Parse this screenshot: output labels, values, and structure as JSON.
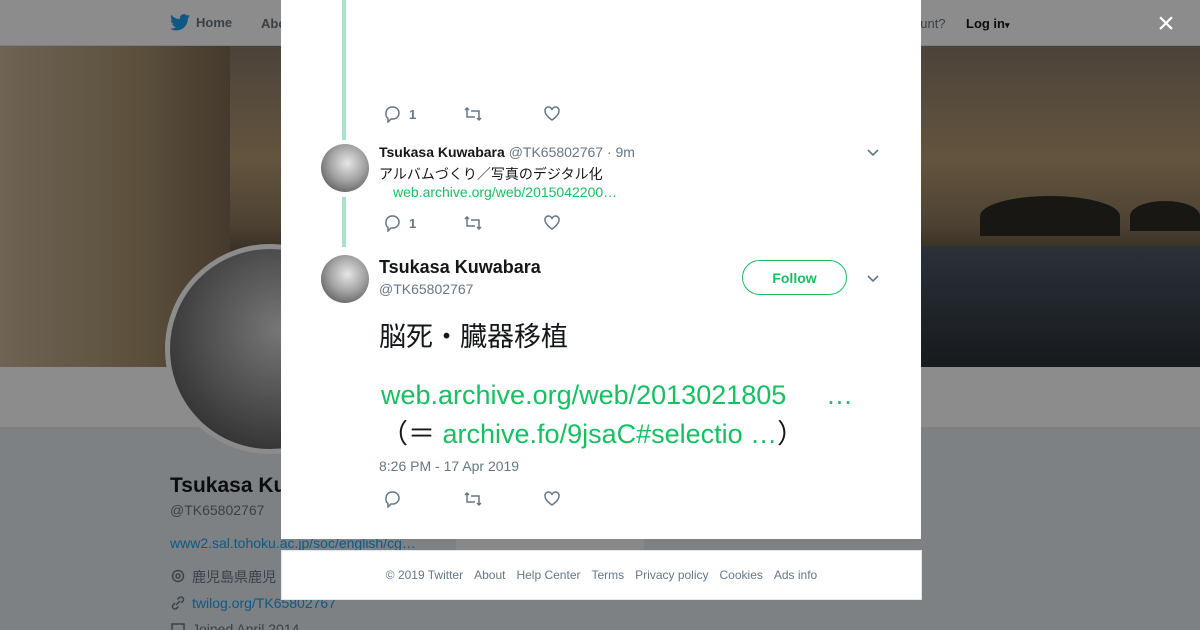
{
  "background": {
    "nav": {
      "home": "Home",
      "about": "Abo",
      "account_prompt": "ccount?",
      "login": "Log in"
    },
    "profile": {
      "name": "Tsukasa Ku",
      "handle": "@TK65802767",
      "website": "www2.sal.tohoku.ac.jp/soc/english/cg…",
      "location": "鹿児島県鹿児",
      "twilog": "twilog.org/TK65802767",
      "joined": "Joined April 2014",
      "ads": "Ads info"
    }
  },
  "modal": {
    "top_actions": {
      "reply_count": "1"
    },
    "reply_tweet": {
      "name": "Tsukasa Kuwabara",
      "handle": "@TK65802767",
      "time": "· 9m",
      "text": "アルバムづくり／写真のデジタル化",
      "link": "web.archive.org/web/2015042200…",
      "reply_count": "1"
    },
    "main_tweet": {
      "name": "Tsukasa Kuwabara",
      "handle": "@TK65802767",
      "follow_label": "Follow",
      "text": "脳死・臓器移植",
      "link1": "web.archive.org/web/2013021805",
      "link1_ellipsis": "…",
      "line2_prefix": "（＝",
      "link2": "archive.fo/9jsaC#selectio …",
      "line2_suffix": "）",
      "timestamp": "8:26 PM - 17 Apr 2019"
    }
  },
  "footer": {
    "items": [
      "© 2019 Twitter",
      "About",
      "Help Center",
      "Terms",
      "Privacy policy",
      "Cookies",
      "Ads info"
    ]
  },
  "close_label": "×",
  "colors": {
    "accent": "#17bf63",
    "thread": "#a7e3c9",
    "twitter_blue": "#1da1f2"
  }
}
